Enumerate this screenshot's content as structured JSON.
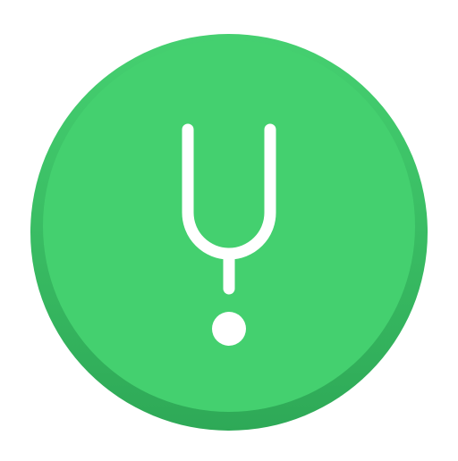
{
  "icon": {
    "name": "tuning-fork-icon",
    "colors": {
      "background": "#ffffff",
      "circle_light": "#44d06f",
      "circle_dark": "#2fae57",
      "glyph": "#ffffff"
    }
  }
}
